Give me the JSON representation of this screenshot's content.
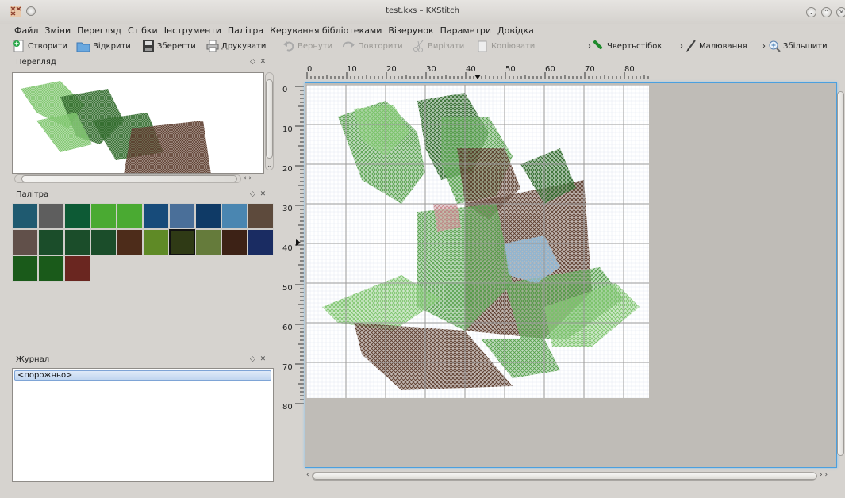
{
  "window": {
    "title": "test.kxs – KXStitch"
  },
  "menu": [
    {
      "label": "Файл"
    },
    {
      "label": "Зміни"
    },
    {
      "label": "Перегляд"
    },
    {
      "label": "Стібки"
    },
    {
      "label": "Інструменти"
    },
    {
      "label": "Палітра"
    },
    {
      "label": "Керування бібліотеками"
    },
    {
      "label": "Візерунок"
    },
    {
      "label": "Параметри"
    },
    {
      "label": "Довідка"
    }
  ],
  "toolbar": {
    "new_label": "Створити",
    "open_label": "Відкрити",
    "save_label": "Зберегти",
    "print_label": "Друкувати",
    "undo_label": "Вернути",
    "redo_label": "Повторити",
    "cut_label": "Вирізати",
    "copy_label": "Копіювати",
    "stitch_label": "Чвертьстібок",
    "draw_label": "Малювання",
    "zoom_label": "Збільшити"
  },
  "docks": {
    "preview_title": "Перегляд",
    "palette_title": "Палітра",
    "history_title": "Журнал"
  },
  "palette": {
    "colors": [
      "#1f5a70",
      "#5e5e5e",
      "#0d5a35",
      "#4aaa32",
      "#4aaa32",
      "#174b7a",
      "#4a6f99",
      "#0f3a66",
      "#4a86b1",
      "#5d4a3c",
      "#61504a",
      "#1b4d2a",
      "#1b4d2a",
      "#1b4d2a",
      "#4d2c1a",
      "#5f8a26",
      "#2f3a15",
      "#657b3b",
      "#3d2216",
      "#1a2c62",
      "#1a5a1a",
      "#1a5a1a",
      "#6a2620"
    ],
    "selected_index": 16
  },
  "history": {
    "items": [
      "<порожньо>"
    ]
  },
  "rulers": {
    "horizontal": [
      "0",
      "10",
      "20",
      "30",
      "40",
      "50",
      "60",
      "70",
      "80"
    ],
    "vertical": [
      "0",
      "10",
      "20",
      "30",
      "40",
      "50",
      "60",
      "70",
      "80"
    ]
  },
  "pattern_colors": {
    "dark_green": "#2f6a2a",
    "light_green": "#7dc56c",
    "mid_green": "#57a14c",
    "brown": "#5b3b2c",
    "light_blue": "#8fbde0",
    "pink": "#c6858a"
  }
}
